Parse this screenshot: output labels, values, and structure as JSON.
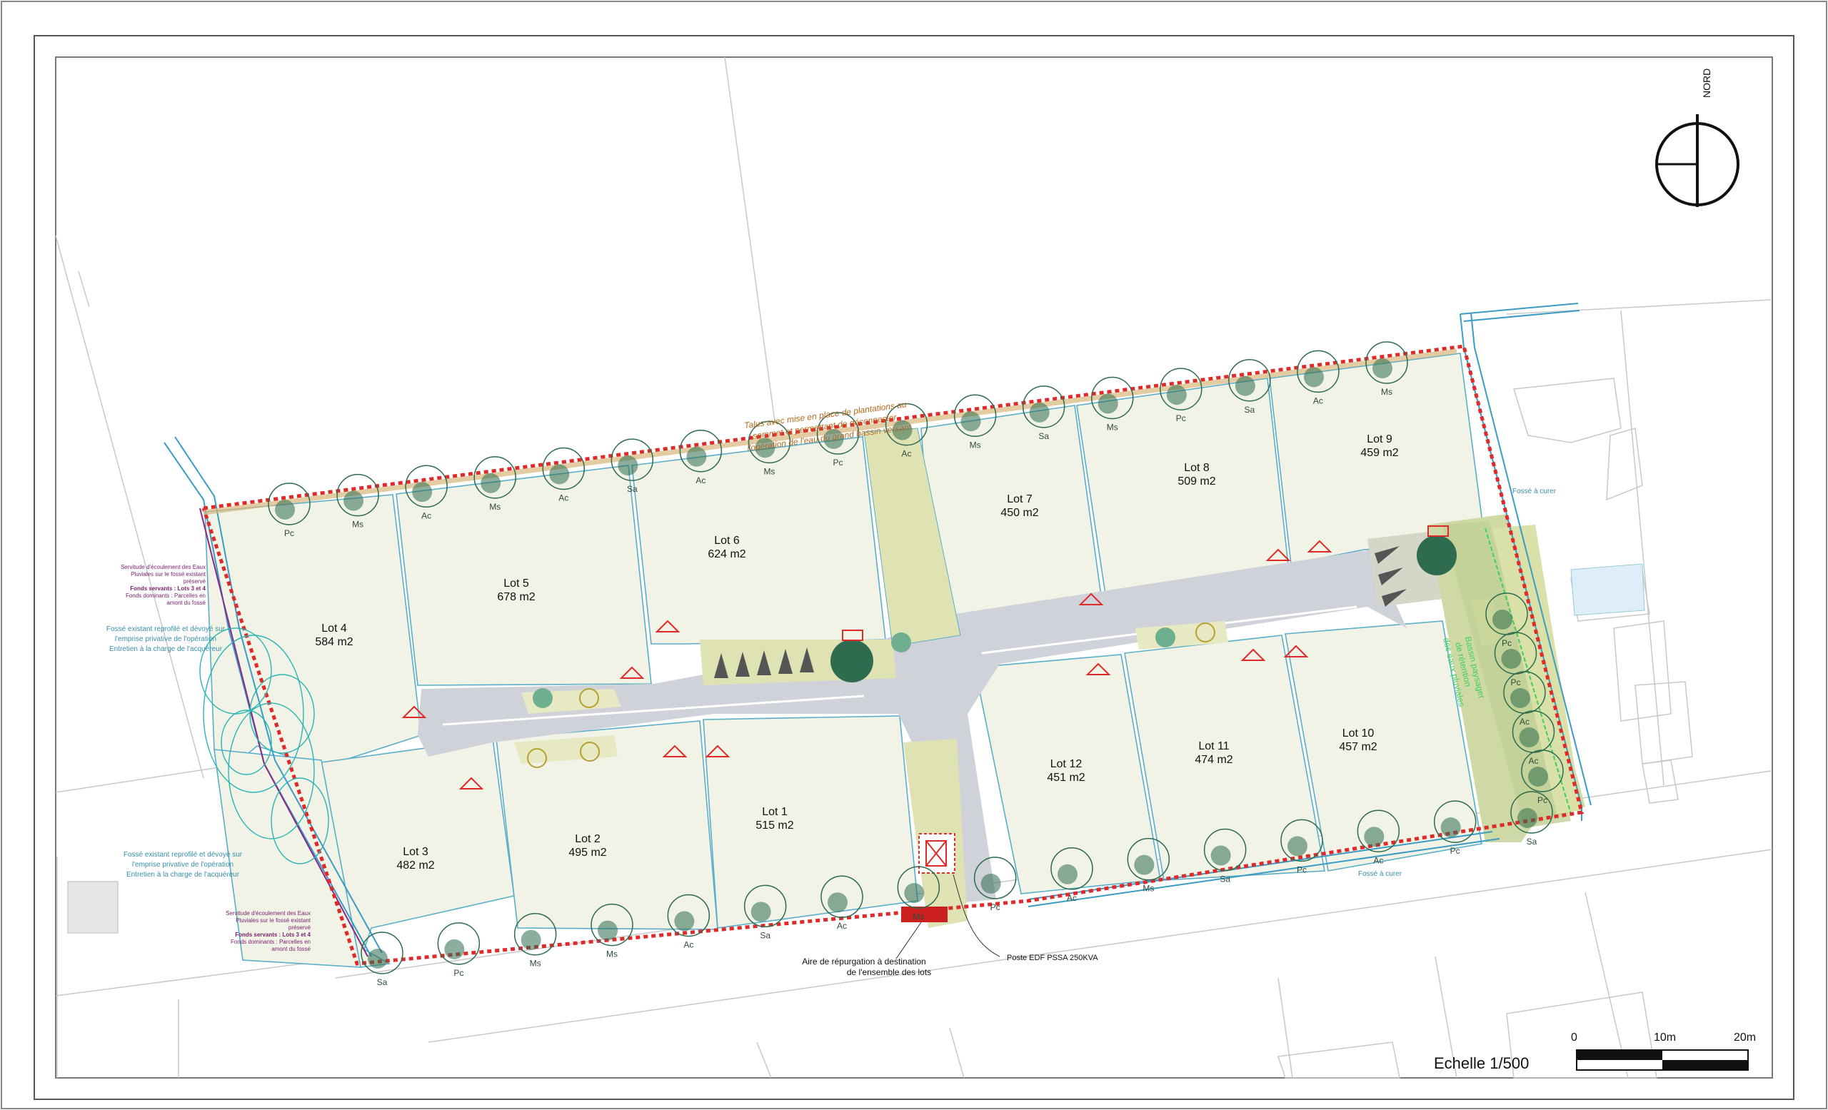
{
  "plan": {
    "north_label": "NORD",
    "scale_title": "Echelle 1/500",
    "scale_ticks": [
      "0",
      "10m",
      "20m"
    ]
  },
  "lots": [
    {
      "name": "Lot 1",
      "area": "515 m2"
    },
    {
      "name": "Lot 2",
      "area": "495 m2"
    },
    {
      "name": "Lot 3",
      "area": "482 m2"
    },
    {
      "name": "Lot 4",
      "area": "584 m2"
    },
    {
      "name": "Lot 5",
      "area": "678 m2"
    },
    {
      "name": "Lot 6",
      "area": "624 m2"
    },
    {
      "name": "Lot 7",
      "area": "450 m2"
    },
    {
      "name": "Lot 8",
      "area": "509 m2"
    },
    {
      "name": "Lot 9",
      "area": "459 m2"
    },
    {
      "name": "Lot 10",
      "area": "457 m2"
    },
    {
      "name": "Lot 11",
      "area": "474 m2"
    },
    {
      "name": "Lot 12",
      "area": "451 m2"
    }
  ],
  "top_trees": [
    "Pc",
    "Ms",
    "Ac",
    "Ms",
    "Ac",
    "Sa",
    "Ac",
    "Ms",
    "Pc",
    "Ac",
    "Ms",
    "Sa",
    "Ms",
    "Pc",
    "Sa",
    "Ac",
    "Ms"
  ],
  "bottom_trees": [
    "Sa",
    "Pc",
    "Ms",
    "Ms",
    "Ac",
    "Sa",
    "Ac",
    "Ms",
    "Pc",
    "Ac",
    "Ms",
    "Sa",
    "Pc",
    "Ac",
    "Pc",
    "Sa"
  ],
  "right_trees": [
    "Pc",
    "Pc",
    "Ac",
    "Ac",
    "Pc"
  ],
  "notes": {
    "talus": [
      "Talus avec mise en place de plantations au",
      "sommet et permettant de déconnecter",
      "l'opération de l'eau du grand bassin versant"
    ],
    "fosse_top": [
      "Fossé existant reprofilé et dévoyé sur",
      "l'emprise privative de l'opération",
      "Entretien à la charge de l'acquéreur"
    ],
    "fosse_bottom": [
      "Fossé existant reprofilé et dévoyé sur",
      "l'emprise privative de l'opération",
      "Entretien à la charge de l'acquéreur"
    ],
    "servitude_top": [
      "Servitude d'écoulement des Eaux",
      "Pluviales sur le fossé existant",
      "préservé",
      "Fonds servants : Lots 3 et 4",
      "Fonds dominants : Parcelles en",
      "amont du fossé"
    ],
    "servitude_bottom": [
      "Servitude d'écoulement des Eaux",
      "Pluviales sur le fossé existant",
      "préservé",
      "Fonds servants : Lots 3 et 4",
      "Fonds dominants : Parcelles en",
      "amont du fossé"
    ],
    "fosse_curer_top": "Fossé à curer",
    "fosse_curer_bottom": "Fossé à curer",
    "bassin": [
      "Bassin paysager",
      "de rétention",
      "des eaux pluviales"
    ],
    "aire": [
      "Aire de répurgation à destination",
      "de l'ensemble des lots"
    ],
    "poste": "Poste EDF PSSA 250KVA"
  },
  "colors": {
    "lot_fill": "#f1f3e6",
    "road": "#d0d2da",
    "green_strip": "#dfe3b4",
    "boundary": "#e02a2a",
    "lot_edge": "#5aaec9",
    "tree": "#2e6b4f",
    "ditch": "#3a9bc4",
    "bassin": "#cdd9a8"
  }
}
